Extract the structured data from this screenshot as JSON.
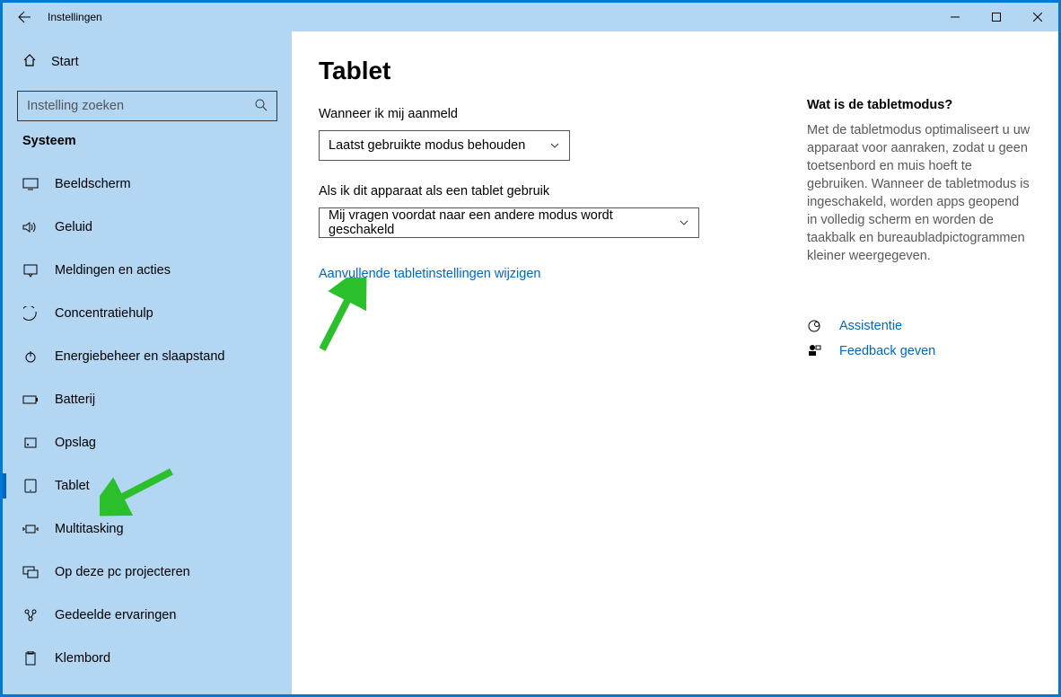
{
  "titlebar": {
    "title": "Instellingen"
  },
  "sidebar": {
    "home": "Start",
    "search_placeholder": "Instelling zoeken",
    "category": "Systeem",
    "items": [
      {
        "label": "Beeldscherm"
      },
      {
        "label": "Geluid"
      },
      {
        "label": "Meldingen en acties"
      },
      {
        "label": "Concentratiehulp"
      },
      {
        "label": "Energiebeheer en slaapstand"
      },
      {
        "label": "Batterij"
      },
      {
        "label": "Opslag"
      },
      {
        "label": "Tablet"
      },
      {
        "label": "Multitasking"
      },
      {
        "label": "Op deze pc projecteren"
      },
      {
        "label": "Gedeelde ervaringen"
      },
      {
        "label": "Klembord"
      }
    ]
  },
  "page": {
    "heading": "Tablet",
    "signin_label": "Wanneer ik mij aanmeld",
    "signin_value": "Laatst gebruikte modus behouden",
    "usage_label": "Als ik dit apparaat als een tablet gebruik",
    "usage_value": "Mij vragen voordat naar een andere modus wordt geschakeld",
    "additional_link": "Aanvullende tabletinstellingen wijzigen"
  },
  "aside": {
    "heading": "Wat is de tabletmodus?",
    "body": "Met de tabletmodus optimaliseert u uw apparaat voor aanraken, zodat u geen toetsenbord en muis hoeft te gebruiken. Wanneer de tabletmodus is ingeschakeld, worden apps geopend in volledig scherm en worden de taakbalk en bureaubladpictogrammen kleiner weergegeven.",
    "help": "Assistentie",
    "feedback": "Feedback geven"
  }
}
